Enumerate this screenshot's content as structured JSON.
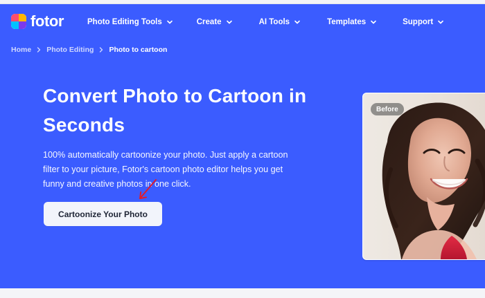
{
  "brand": {
    "name": "fotor",
    "icon": "fotor-logo-icon"
  },
  "nav": {
    "items": [
      {
        "label": "Photo Editing Tools",
        "icon": "chevron-down-icon"
      },
      {
        "label": "Create",
        "icon": "chevron-down-icon"
      },
      {
        "label": "AI Tools",
        "icon": "chevron-down-icon"
      },
      {
        "label": "Templates",
        "icon": "chevron-down-icon"
      },
      {
        "label": "Support",
        "icon": "chevron-down-icon"
      }
    ]
  },
  "breadcrumb": {
    "items": [
      "Home",
      "Photo Editing",
      "Photo to cartoon"
    ],
    "separator_icon": "chevron-right-icon"
  },
  "hero": {
    "title_line1": "Convert Photo to Cartoon in",
    "title_line2": "Seconds",
    "description_line1": "100% automatically cartoonize your photo. Just apply a cartoon",
    "description_line2": "filter to your picture, Fotor's cartoon photo editor helps you get",
    "description_line3": "funny and creative photos in one click.",
    "cta_label": "Cartoonize Your Photo"
  },
  "preview": {
    "badge": "Before"
  },
  "colors": {
    "hero_bg": "#3b5cff",
    "text_on_hero": "#ffffff",
    "cta_bg": "#f2f4fb",
    "cta_text": "#1e2435",
    "annotation_arrow": "#e21b2a"
  }
}
